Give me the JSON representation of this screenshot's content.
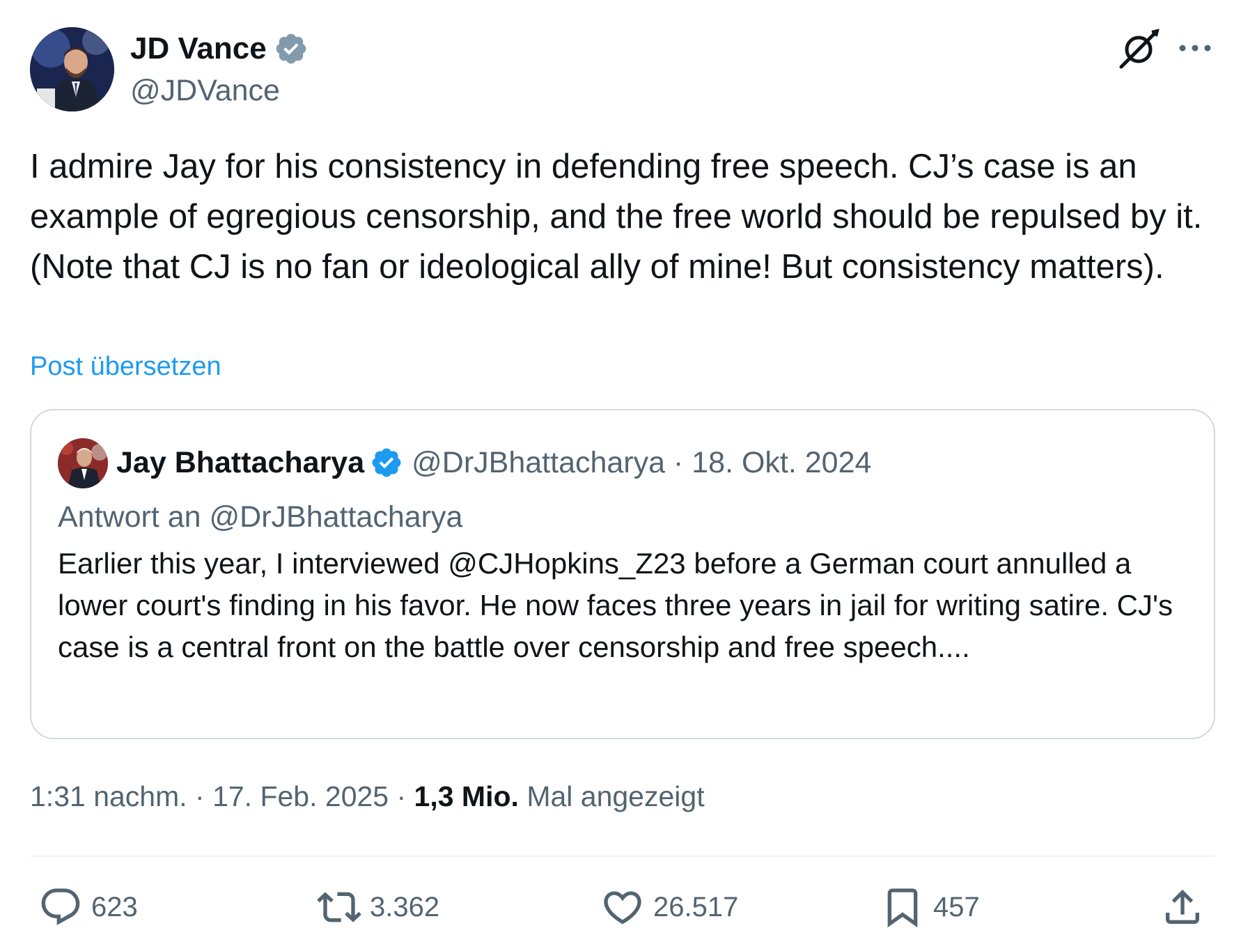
{
  "author": {
    "name": "JD Vance",
    "handle": "@JDVance"
  },
  "tweet": {
    "text": "I admire Jay for his consistency in defending free speech. CJ’s case is an example of egregious censorship, and the free world should be repulsed by it. (Note that CJ is no fan or ideological ally of mine! But consistency matters).",
    "translate_label": "Post übersetzen"
  },
  "quote": {
    "name": "Jay Bhattacharya",
    "handle_date": "@DrJBhattacharya · 18. Okt. 2024",
    "reply_to": "Antwort an @DrJBhattacharya",
    "text": "Earlier this year, I interviewed @CJHopkins_Z23 before a German court annulled a lower court's finding in his favor. He now faces three years in jail for writing satire. CJ's case is a central front on the battle over censorship and free speech...."
  },
  "meta": {
    "time_date": "1:31 nachm. · 17. Feb. 2025 · ",
    "views_count": "1,3 Mio.",
    "views_label": " Mal angezeigt"
  },
  "actions": {
    "replies": "623",
    "reposts": "3.362",
    "likes": "26.517",
    "bookmarks": "457"
  },
  "colors": {
    "verified_badge": "#829aab",
    "quote_verified_badge": "#1d9bf0",
    "link": "#1d9bf0",
    "secondary_text": "#536471",
    "border": "#cfd9de"
  },
  "icons": [
    "verified-badge-icon",
    "grok-icon",
    "more-icon",
    "reply-icon",
    "repost-icon",
    "like-icon",
    "bookmark-icon",
    "share-icon"
  ]
}
